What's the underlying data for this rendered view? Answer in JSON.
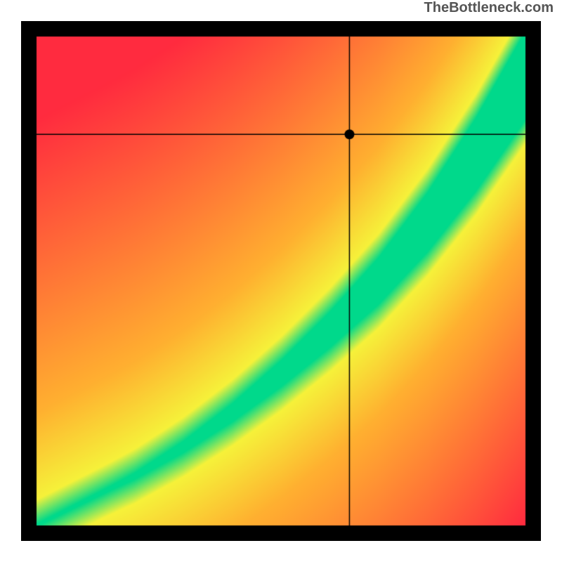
{
  "attribution": "TheBottleneck.com",
  "chart_data": {
    "type": "heatmap",
    "title": "",
    "xlabel": "",
    "ylabel": "",
    "xlim": [
      0,
      1
    ],
    "ylim": [
      0,
      1
    ],
    "marker": {
      "x": 0.64,
      "y": 0.8
    },
    "ridge": {
      "description": "green optimal band along a diagonal curve; value peaks on the ridge and falls off to red away from it",
      "points": [
        {
          "x": 0.0,
          "y": 0.0
        },
        {
          "x": 0.1,
          "y": 0.05
        },
        {
          "x": 0.2,
          "y": 0.1
        },
        {
          "x": 0.3,
          "y": 0.16
        },
        {
          "x": 0.4,
          "y": 0.23
        },
        {
          "x": 0.5,
          "y": 0.31
        },
        {
          "x": 0.6,
          "y": 0.4
        },
        {
          "x": 0.7,
          "y": 0.5
        },
        {
          "x": 0.8,
          "y": 0.62
        },
        {
          "x": 0.9,
          "y": 0.76
        },
        {
          "x": 1.0,
          "y": 0.92
        }
      ],
      "band_halfwidth_start": 0.015,
      "band_halfwidth_end": 0.09
    },
    "colors": {
      "best": "#00d98b",
      "good": "#f6f23a",
      "mid": "#ffb030",
      "bad": "#ff2b3f",
      "frame": "#000000",
      "marker": "#000000"
    }
  }
}
